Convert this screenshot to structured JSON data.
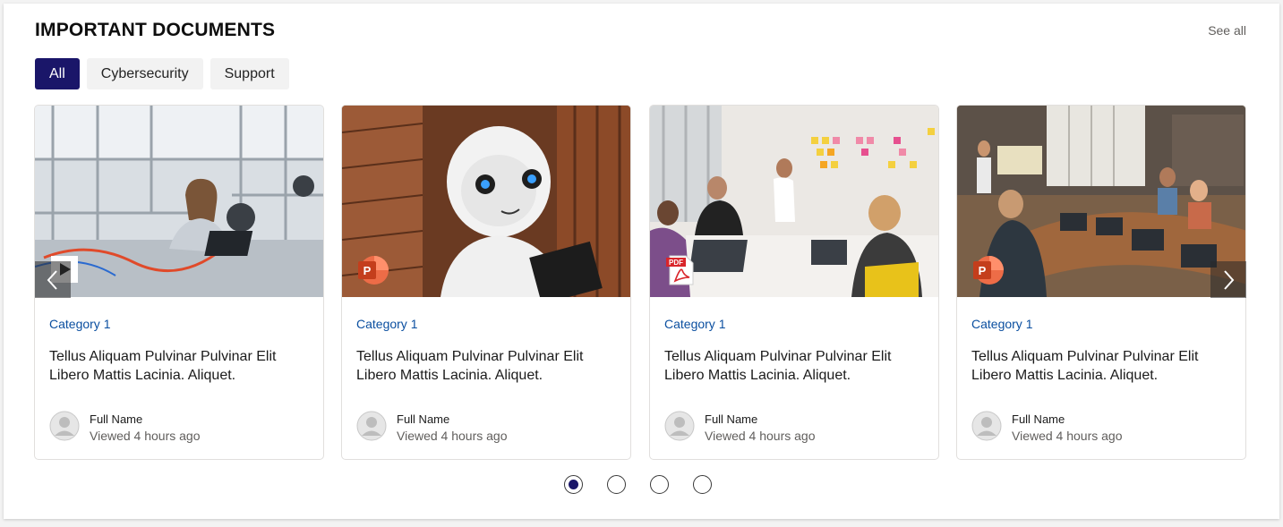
{
  "section": {
    "title": "IMPORTANT DOCUMENTS",
    "see_all": "See all"
  },
  "tabs": [
    {
      "label": "All",
      "active": true
    },
    {
      "label": "Cybersecurity",
      "active": false
    },
    {
      "label": "Support",
      "active": false
    }
  ],
  "cards": [
    {
      "category": "Category 1",
      "title": "Tellus Aliquam Pulvinar Pulvinar Elit Libero Mattis Lacinia. Aliquet.",
      "author": "Full Name",
      "viewed": "Viewed 4 hours ago",
      "file_icon": "video-icon",
      "image": "engineer-in-lab"
    },
    {
      "category": "Category 1",
      "title": "Tellus Aliquam Pulvinar Pulvinar Elit Libero Mattis Lacinia. Aliquet.",
      "author": "Full Name",
      "viewed": "Viewed 4 hours ago",
      "file_icon": "powerpoint-icon",
      "file_letter": "P",
      "image": "humanoid-robot"
    },
    {
      "category": "Category 1",
      "title": "Tellus Aliquam Pulvinar Pulvinar Elit Libero Mattis Lacinia. Aliquet.",
      "author": "Full Name",
      "viewed": "Viewed 4 hours ago",
      "file_icon": "pdf-icon",
      "file_letter": "PDF",
      "image": "team-sticky-notes"
    },
    {
      "category": "Category 1",
      "title": "Tellus Aliquam Pulvinar Pulvinar Elit Libero Mattis Lacinia. Aliquet.",
      "author": "Full Name",
      "viewed": "Viewed 4 hours ago",
      "file_icon": "powerpoint-icon",
      "file_letter": "P",
      "image": "conference-meeting"
    }
  ],
  "carousel": {
    "pages": 4,
    "current": 1
  },
  "colors": {
    "accent": "#1a1669",
    "category": "#0b4fa0",
    "powerpoint": "#d24726",
    "pdf": "#d9252a"
  }
}
